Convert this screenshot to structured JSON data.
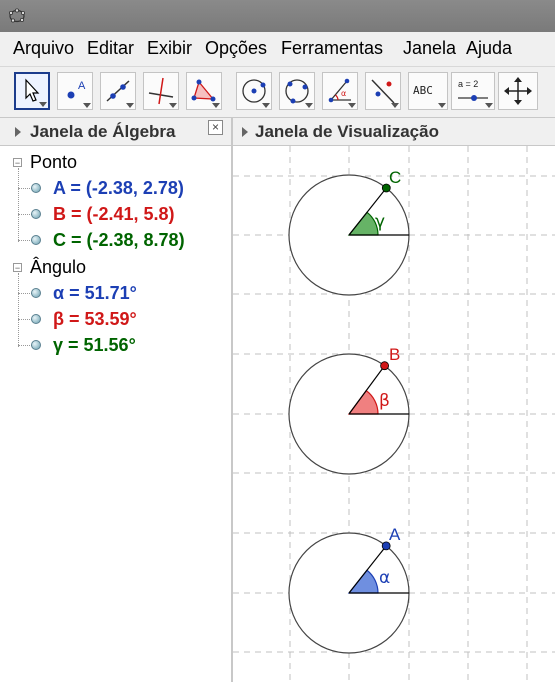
{
  "menubar": {
    "items": [
      "Arquivo",
      "Editar",
      "Exibir",
      "Opções",
      "Ferramentas",
      "Janela",
      "Ajuda"
    ]
  },
  "toolbar": {
    "tools": [
      "move-tool",
      "point-tool",
      "line-tool",
      "perpendicular-line-tool",
      "polygon-tool",
      "circle-center-point-tool",
      "circle-three-points-tool",
      "angle-tool",
      "reflect-tool",
      "text-tool",
      "slider-tool",
      "move-view-tool"
    ],
    "text_tool_label": "ABC",
    "slider_label": "a = 2"
  },
  "algebra": {
    "title": "Janela de Álgebra",
    "close": "×",
    "groups": [
      {
        "label": "Ponto",
        "items": [
          {
            "text": "A = (-2.38, 2.78)",
            "color": "#1c3fb4"
          },
          {
            "text": "B = (-2.41, 5.8)",
            "color": "#d01818"
          },
          {
            "text": "C = (-2.38, 8.78)",
            "color": "#006400"
          }
        ]
      },
      {
        "label": "Ângulo",
        "items": [
          {
            "text": "α = 51.71°",
            "color": "#1c3fb4"
          },
          {
            "text": "β = 53.59°",
            "color": "#d01818"
          },
          {
            "text": "γ = 51.56°",
            "color": "#006400"
          }
        ]
      }
    ]
  },
  "graphics": {
    "title": "Janela de Visualização",
    "figures": [
      {
        "point_label": "C",
        "angle_label": "γ",
        "angle_deg": 51.56,
        "color": "#006400",
        "fill": "#66b366"
      },
      {
        "point_label": "B",
        "angle_label": "β",
        "angle_deg": 53.59,
        "color": "#d01818",
        "fill": "#f08080"
      },
      {
        "point_label": "A",
        "angle_label": "α",
        "angle_deg": 51.71,
        "color": "#1c3fb4",
        "fill": "#6f8fe0"
      }
    ]
  }
}
